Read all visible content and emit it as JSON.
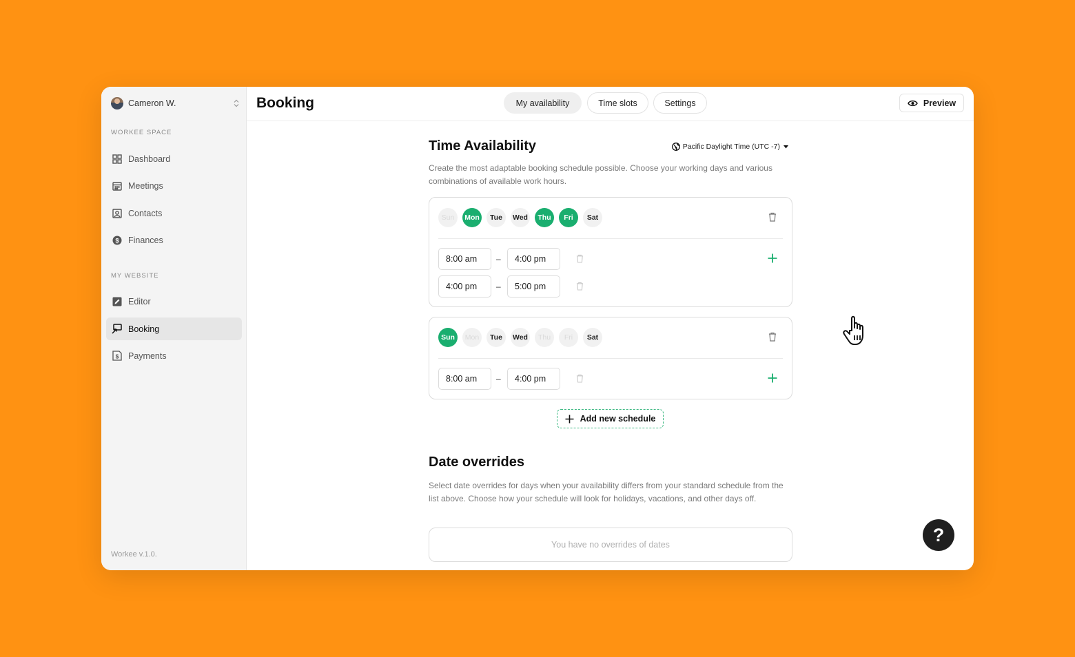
{
  "sidebar": {
    "account_name": "Cameron W.",
    "sections": [
      {
        "label": "WORKEE SPACE",
        "items": [
          {
            "label": "Dashboard",
            "icon": "dashboard-icon"
          },
          {
            "label": "Meetings",
            "icon": "calendar-icon"
          },
          {
            "label": "Contacts",
            "icon": "contact-icon"
          },
          {
            "label": "Finances",
            "icon": "dollar-icon"
          }
        ]
      },
      {
        "label": "MY WEBSITE",
        "items": [
          {
            "label": "Editor",
            "icon": "edit-icon"
          },
          {
            "label": "Booking",
            "icon": "booking-icon",
            "active": true
          },
          {
            "label": "Payments",
            "icon": "payments-icon"
          }
        ]
      }
    ],
    "version": "Workee v.1.0."
  },
  "header": {
    "title": "Booking",
    "tabs": [
      {
        "label": "My availability",
        "active": true
      },
      {
        "label": "Time slots"
      },
      {
        "label": "Settings"
      }
    ],
    "preview_label": "Preview"
  },
  "availability": {
    "title": "Time Availability",
    "timezone": "Pacific Daylight Time (UTC -7)",
    "description": "Create the most adaptable booking schedule possible. Choose your working days and various combinations of available work hours.",
    "schedules": [
      {
        "days": [
          {
            "label": "Sun",
            "state": "off"
          },
          {
            "label": "Mon",
            "state": "on"
          },
          {
            "label": "Tue",
            "state": "available"
          },
          {
            "label": "Wed",
            "state": "available"
          },
          {
            "label": "Thu",
            "state": "on"
          },
          {
            "label": "Fri",
            "state": "on"
          },
          {
            "label": "Sat",
            "state": "available"
          }
        ],
        "ranges": [
          {
            "start": "8:00 am",
            "end": "4:00 pm"
          },
          {
            "start": "4:00 pm",
            "end": "5:00 pm"
          }
        ]
      },
      {
        "days": [
          {
            "label": "Sun",
            "state": "on"
          },
          {
            "label": "Mon",
            "state": "off"
          },
          {
            "label": "Tue",
            "state": "available"
          },
          {
            "label": "Wed",
            "state": "available"
          },
          {
            "label": "Thu",
            "state": "off"
          },
          {
            "label": "Fri",
            "state": "off"
          },
          {
            "label": "Sat",
            "state": "available"
          }
        ],
        "ranges": [
          {
            "start": "8:00 am",
            "end": "4:00 pm"
          }
        ]
      }
    ],
    "range_separator": "–",
    "add_schedule_label": "Add new schedule"
  },
  "overrides": {
    "title": "Date overrides",
    "description": "Select date overrides for days when your availability differs from your standard schedule from the list above. Choose how your schedule will look for holidays, vacations, and other days off.",
    "empty_text": "You have no overrides of dates"
  },
  "help_label": "?",
  "colors": {
    "background": "#FF9212",
    "accent": "#1AAE6F",
    "help": "#1F1F1F"
  }
}
